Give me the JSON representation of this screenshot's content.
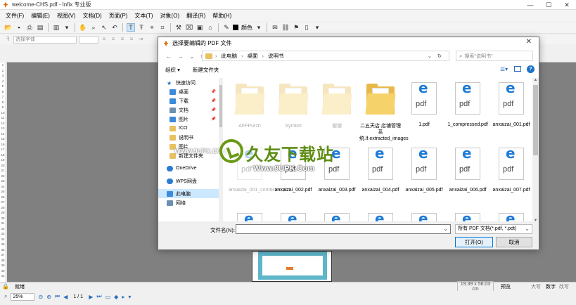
{
  "app": {
    "title": "welcome-CHS.pdf - Infix 专业版",
    "window_controls": [
      "—",
      "☐",
      "✕"
    ]
  },
  "menu": [
    "文件(F)",
    "编辑(E)",
    "视图(V)",
    "文档(D)",
    "页面(P)",
    "文本(T)",
    "对象(O)",
    "翻译(R)",
    "帮助(H)"
  ],
  "toolbar": {
    "color_label": "颜色"
  },
  "fontbar": {
    "font_placeholder": "选择字体"
  },
  "status": {
    "ready": "就绪",
    "coords": "19.39 x 56.03 cm",
    "mode": "预览",
    "caps": "大写",
    "num": "数字",
    "ovr": "改写"
  },
  "navbar": {
    "zoom": "25%",
    "page": "1 / 1"
  },
  "ruler_numbers": [
    "1",
    "2",
    "3",
    "4",
    "5",
    "6",
    "7",
    "8",
    "9",
    "10",
    "11",
    "12",
    "13",
    "14",
    "15",
    "16",
    "17",
    "18",
    "19",
    "20",
    "21",
    "22",
    "23",
    "24",
    "25",
    "26",
    "27",
    "28",
    "29",
    "30",
    "31",
    "32",
    "33",
    "34",
    "35",
    "36",
    "37",
    "38",
    "39",
    "40",
    "41"
  ],
  "watermark": {
    "url_left": "WWW.9UPK.COM",
    "brand": "久友下载站",
    "url": "Www.9UPK.Com"
  },
  "dialog": {
    "title": "选择要编辑的 PDF 文件",
    "close": "✕",
    "breadcrumb": [
      "此电脑",
      "桌面",
      "说明书"
    ],
    "search_placeholder": "搜索\"说明书\"",
    "organize": "组织 ▾",
    "new_folder": "新建文件夹",
    "nav_items": [
      {
        "label": "快速访问",
        "icon": "star-icon"
      },
      {
        "label": "桌面",
        "icon": "desktop-icon",
        "pin": true
      },
      {
        "label": "下载",
        "icon": "download-icon",
        "pin": true
      },
      {
        "label": "文档",
        "icon": "documents-icon",
        "pin": true
      },
      {
        "label": "图片",
        "icon": "pictures-icon",
        "pin": true
      },
      {
        "label": "ICO",
        "icon": "folder-icon"
      },
      {
        "label": "说明书",
        "icon": "folder-icon"
      },
      {
        "label": "图片",
        "icon": "folder-icon"
      },
      {
        "label": "新建文件夹",
        "icon": "folder-icon"
      },
      {
        "label": "OneDrive",
        "icon": "onedrive-icon"
      },
      {
        "label": "WPS网盘",
        "icon": "wps-cloud-icon"
      },
      {
        "label": "此电脑",
        "icon": "computer-icon",
        "selected": true
      },
      {
        "label": "网络",
        "icon": "network-icon"
      }
    ],
    "files": [
      {
        "name": "AFFPurch",
        "kind": "folder",
        "faded": true
      },
      {
        "name": "Symbol",
        "kind": "folder",
        "faded": true
      },
      {
        "name": "谢谢",
        "kind": "folder",
        "faded": true
      },
      {
        "name": "二五天店 店铺管理系统.lf.extracted_images",
        "kind": "folder"
      },
      {
        "name": "1.pdf",
        "kind": "pdf"
      },
      {
        "name": "1_compressed.pdf",
        "kind": "pdf"
      },
      {
        "name": "anxaizai_001.pdf",
        "kind": "pdf"
      },
      {
        "name": "anxaizai_001_combined.pdf",
        "kind": "pdf",
        "faded": true
      },
      {
        "name": "anxaizai_002.pdf",
        "kind": "pdf"
      },
      {
        "name": "anxaizai_003.pdf",
        "kind": "pdf"
      },
      {
        "name": "anxaizai_004.pdf",
        "kind": "pdf"
      },
      {
        "name": "anxaizai_005.pdf",
        "kind": "pdf"
      },
      {
        "name": "anxaizai_006.pdf",
        "kind": "pdf"
      },
      {
        "name": "anxaizai_007.pdf",
        "kind": "pdf"
      },
      {
        "name": "",
        "kind": "pdf"
      },
      {
        "name": "",
        "kind": "pdf"
      },
      {
        "name": "",
        "kind": "pdf"
      },
      {
        "name": "",
        "kind": "pdf"
      },
      {
        "name": "",
        "kind": "pdf"
      },
      {
        "name": "",
        "kind": "pdf"
      },
      {
        "name": "",
        "kind": "pdf"
      }
    ],
    "filename_label": "文件名(N):",
    "filename_value": "",
    "filetype": "所有 PDF 文档(*.pdf, *.pdt)",
    "open_button": "打开(O)",
    "cancel_button": "取消"
  }
}
